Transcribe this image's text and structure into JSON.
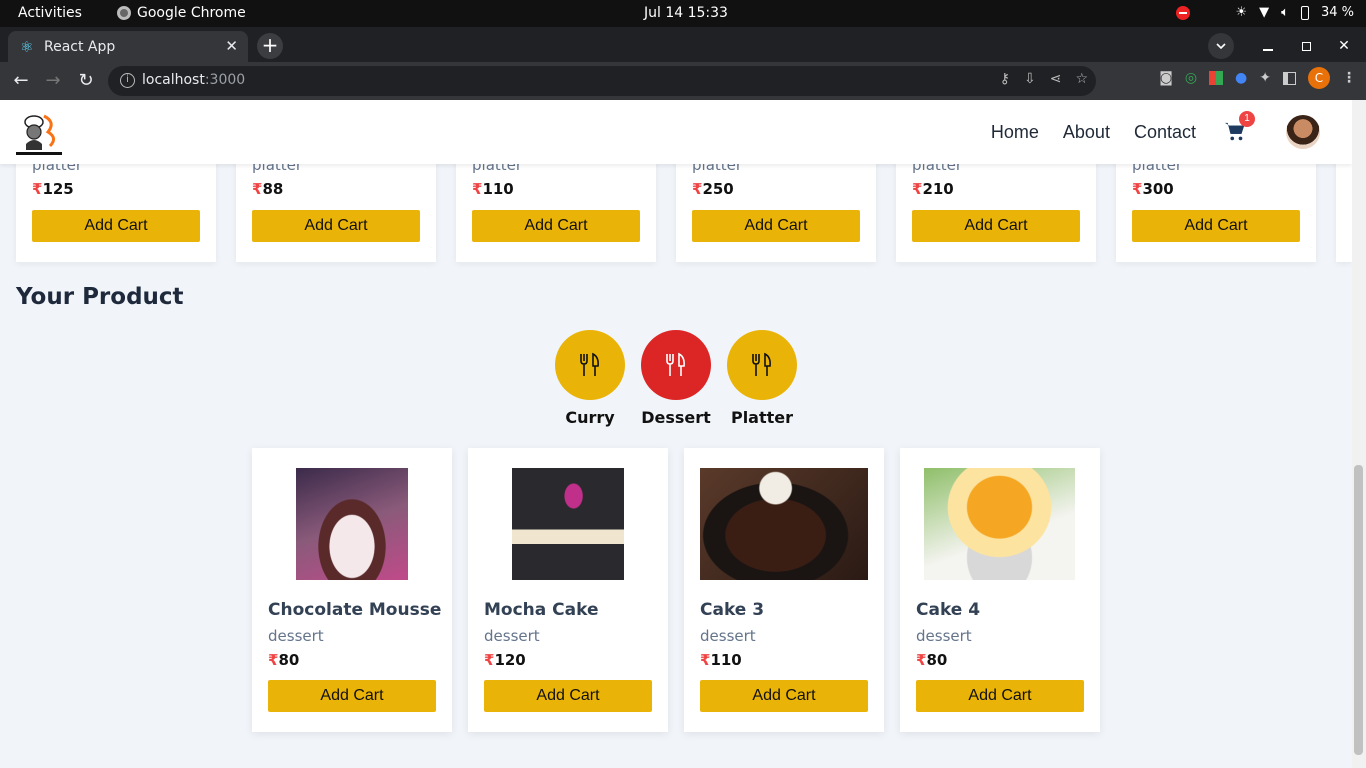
{
  "os": {
    "activities": "Activities",
    "app_name": "Google Chrome",
    "datetime": "Jul 14  15:33",
    "battery": "34 %"
  },
  "browser": {
    "tab_title": "React App",
    "url_host": "localhost",
    "url_port": ":3000",
    "profile_initial": "C"
  },
  "header": {
    "nav": [
      "Home",
      "About",
      "Contact"
    ],
    "cart_count": "1"
  },
  "top_cards": [
    {
      "category": "platter",
      "price": "125",
      "button": "Add Cart"
    },
    {
      "category": "platter",
      "price": "88",
      "button": "Add Cart"
    },
    {
      "category": "platter",
      "price": "110",
      "button": "Add Cart"
    },
    {
      "category": "platter",
      "price": "250",
      "button": "Add Cart"
    },
    {
      "category": "platter",
      "price": "210",
      "button": "Add Cart"
    },
    {
      "category": "platter",
      "price": "300",
      "button": "Add Cart"
    }
  ],
  "currency": "₹",
  "section_title": "Your Product",
  "filters": [
    {
      "label": "Curry",
      "active": false
    },
    {
      "label": "Dessert",
      "active": true
    },
    {
      "label": "Platter",
      "active": false
    }
  ],
  "products": [
    {
      "name": "Chocolate Mousse",
      "category": "dessert",
      "price": "80",
      "button": "Add Cart"
    },
    {
      "name": "Mocha Cake",
      "category": "dessert",
      "price": "120",
      "button": "Add Cart"
    },
    {
      "name": "Cake 3",
      "category": "dessert",
      "price": "110",
      "button": "Add Cart"
    },
    {
      "name": "Cake 4",
      "category": "dessert",
      "price": "80",
      "button": "Add Cart"
    }
  ],
  "colors": {
    "accent_yellow": "#eab308",
    "active_red": "#dc2626",
    "rupee_red": "#ef4444"
  }
}
